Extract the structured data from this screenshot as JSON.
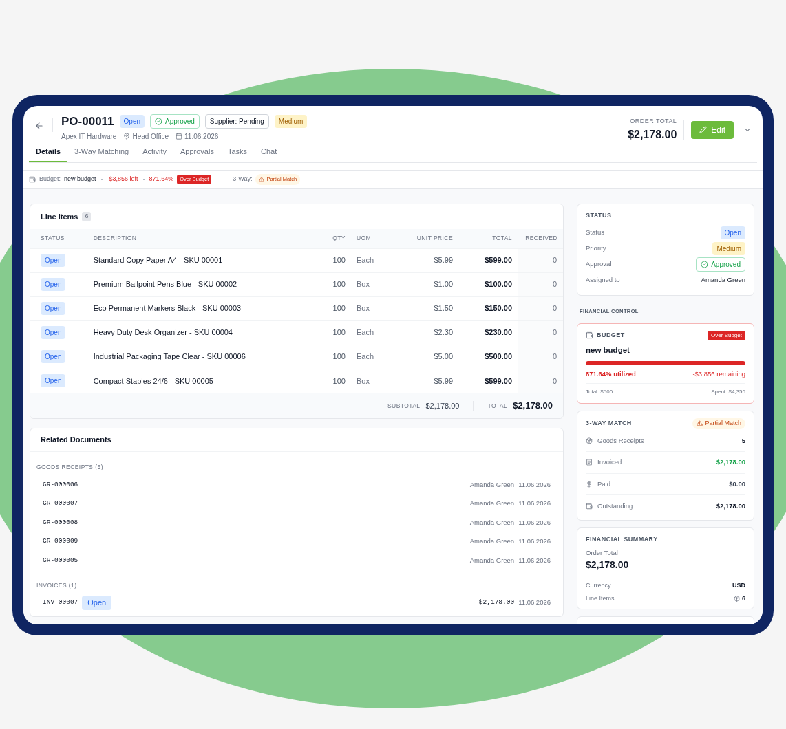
{
  "header": {
    "title": "PO-00011",
    "badges": [
      {
        "label": "Open",
        "kind": "open"
      },
      {
        "label": "Approved",
        "kind": "approved"
      },
      {
        "label": "Supplier: Pending",
        "kind": "outline"
      },
      {
        "label": "Medium",
        "kind": "medium"
      }
    ],
    "supplier": "Apex IT Hardware",
    "location": "Head Office",
    "date": "11.06.2026",
    "order_total_label": "ORDER TOTAL",
    "order_total": "$2,178.00",
    "edit_button": "Edit"
  },
  "tabs": [
    {
      "label": "Details",
      "selected": true
    },
    {
      "label": "3-Way Matching",
      "selected": false
    },
    {
      "label": "Activity",
      "selected": false
    },
    {
      "label": "Approvals",
      "selected": false
    },
    {
      "label": "Tasks",
      "selected": false
    },
    {
      "label": "Chat",
      "selected": false
    }
  ],
  "budget_strip": {
    "label": "Budget:",
    "name": "new budget",
    "left": "-$3,856 left",
    "percent": "871.64%",
    "badge": "Over Budget",
    "three_way_label": "3-Way:",
    "three_way_badge": "Partial Match"
  },
  "line_items": {
    "title": "Line Items",
    "count": "6",
    "columns": [
      "STATUS",
      "DESCRIPTION",
      "QTY",
      "UOM",
      "UNIT PRICE",
      "TOTAL",
      "RECEIVED"
    ],
    "rows": [
      {
        "status": "Open",
        "description": "Standard Copy Paper A4 - SKU 00001",
        "qty": "100",
        "uom": "Each",
        "unit_price": "$5.99",
        "total": "$599.00",
        "received": "0"
      },
      {
        "status": "Open",
        "description": "Premium Ballpoint Pens Blue - SKU 00002",
        "qty": "100",
        "uom": "Box",
        "unit_price": "$1.00",
        "total": "$100.00",
        "received": "0"
      },
      {
        "status": "Open",
        "description": "Eco Permanent Markers Black - SKU 00003",
        "qty": "100",
        "uom": "Box",
        "unit_price": "$1.50",
        "total": "$150.00",
        "received": "0"
      },
      {
        "status": "Open",
        "description": "Heavy Duty Desk Organizer - SKU 00004",
        "qty": "100",
        "uom": "Each",
        "unit_price": "$2.30",
        "total": "$230.00",
        "received": "0"
      },
      {
        "status": "Open",
        "description": "Industrial Packaging Tape Clear - SKU 00006",
        "qty": "100",
        "uom": "Each",
        "unit_price": "$5.00",
        "total": "$500.00",
        "received": "0"
      },
      {
        "status": "Open",
        "description": "Compact Staples 24/6 - SKU 00005",
        "qty": "100",
        "uom": "Box",
        "unit_price": "$5.99",
        "total": "$599.00",
        "received": "0"
      }
    ],
    "subtotal_label": "SUBTOTAL",
    "subtotal": "$2,178.00",
    "total_label": "TOTAL",
    "total": "$2,178.00"
  },
  "related_documents": {
    "title": "Related Documents",
    "groups": [
      {
        "heading": "GOODS RECEIPTS (5)",
        "items": [
          {
            "number": "GR-000006",
            "person": "Amanda Green",
            "date": "11.06.2026"
          },
          {
            "number": "GR-000007",
            "person": "Amanda Green",
            "date": "11.06.2026"
          },
          {
            "number": "GR-000008",
            "person": "Amanda Green",
            "date": "11.06.2026"
          },
          {
            "number": "GR-000009",
            "person": "Amanda Green",
            "date": "11.06.2026"
          },
          {
            "number": "GR-000005",
            "person": "Amanda Green",
            "date": "11.06.2026"
          }
        ]
      },
      {
        "heading": "INVOICES (1)",
        "items": [
          {
            "number": "INV-00007",
            "status": "Open",
            "amount": "$2,178.00",
            "date": "11.06.2026"
          }
        ]
      }
    ]
  },
  "status_card": {
    "title": "STATUS",
    "rows": [
      {
        "label": "Status",
        "value": "Open",
        "kind": "open"
      },
      {
        "label": "Priority",
        "value": "Medium",
        "kind": "medium"
      },
      {
        "label": "Approval",
        "value": "Approved",
        "kind": "approved"
      },
      {
        "label": "Assigned to",
        "value": "Amanda Green",
        "kind": "text"
      }
    ]
  },
  "financial_control_label": "FINANCIAL CONTROL",
  "budget_card": {
    "title": "BUDGET",
    "badge": "Over Budget",
    "name": "new budget",
    "level": 1,
    "utilized": "871.64% utilized",
    "remaining": "-$3,856 remaining",
    "total": "Total: $500",
    "spent": "Spent: $4,356"
  },
  "three_way_match": {
    "title": "3-WAY MATCH",
    "badge": "Partial Match",
    "rows": [
      {
        "label": "Goods Receipts",
        "value": "5",
        "color": "#111827"
      },
      {
        "label": "Invoiced",
        "value": "$2,178.00",
        "color": "#16a34a"
      },
      {
        "label": "Paid",
        "value": "$0.00",
        "color": "#374151"
      },
      {
        "label": "Outstanding",
        "value": "$2,178.00",
        "color": "#111827"
      }
    ]
  },
  "financial_summary": {
    "title": "FINANCIAL SUMMARY",
    "order_total_label": "Order Total",
    "order_total": "$2,178.00",
    "rows": [
      {
        "label": "Currency",
        "value": "USD"
      },
      {
        "label": "Line Items",
        "value": "6"
      }
    ]
  }
}
